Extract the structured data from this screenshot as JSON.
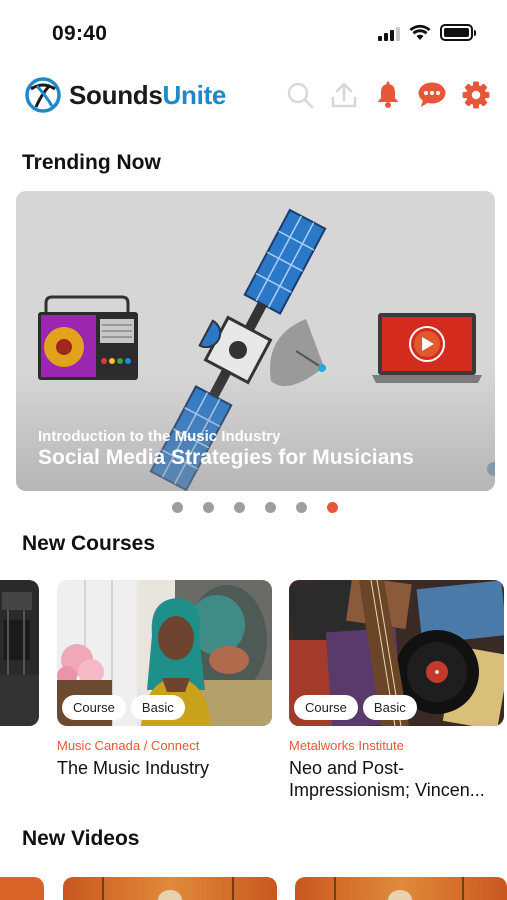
{
  "status": {
    "time": "09:40"
  },
  "header": {
    "logo_sounds": "Sounds",
    "logo_unite": "Unite",
    "accent": "#e8563a",
    "brand_blue": "#1e88c8"
  },
  "trending": {
    "heading": "Trending Now",
    "slide": {
      "subtitle": "Introduction to the Music Industry",
      "title": "Social Media Strategies for Musicians"
    },
    "slide_count": 6,
    "active_slide": 6
  },
  "new_courses": {
    "heading": "New Courses",
    "items": [
      {
        "tag1": "Course",
        "tag2": "Basic",
        "org": "Music Canada / Connect",
        "title": "The Music Industry"
      },
      {
        "tag1": "Course",
        "tag2": "Basic",
        "org": "Metalworks Institute",
        "title": "Neo and Post-Impressionism; Vincen..."
      }
    ]
  },
  "new_videos": {
    "heading": "New Videos"
  }
}
